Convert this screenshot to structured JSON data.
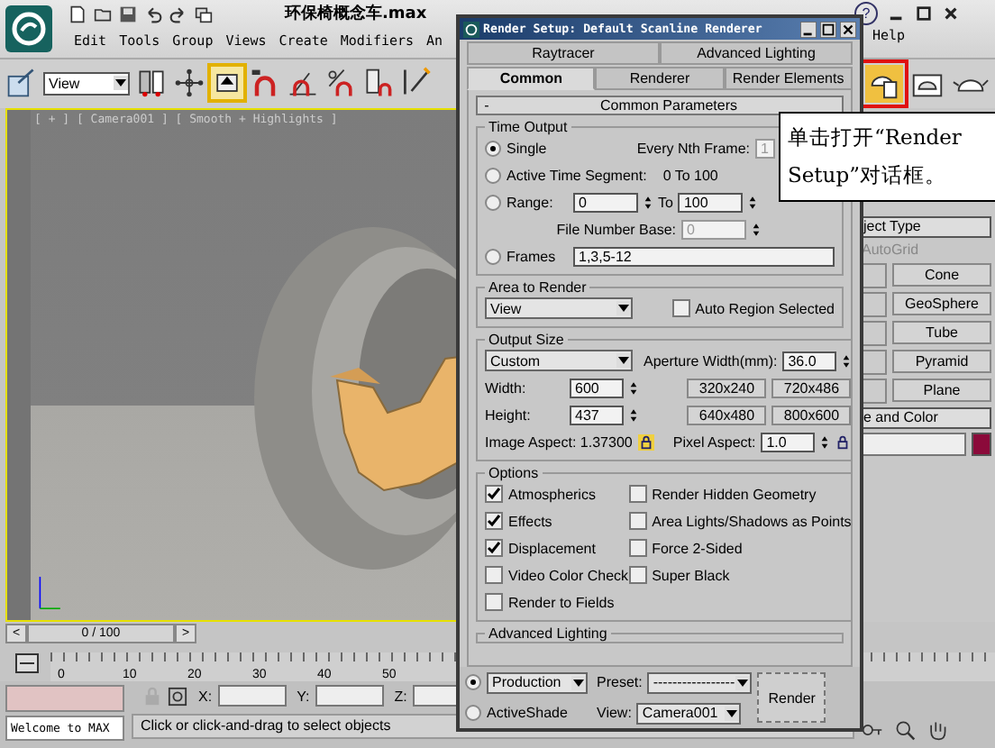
{
  "app": {
    "title": "环保椅概念车.max",
    "menu": [
      "Edit",
      "Tools",
      "Group",
      "Views",
      "Create",
      "Modifiers",
      "An"
    ],
    "help_glyph": "?",
    "help_menu": "Help"
  },
  "toolbar": {
    "view_dropdown": "View"
  },
  "viewport": {
    "label": "[ + ] [ Camera001 ] [ Smooth + Highlights ]"
  },
  "time_slider": {
    "prev": "<",
    "position": "0 / 100",
    "next": ">"
  },
  "track_bar": {
    "ticks": [
      "0",
      "10",
      "20",
      "30",
      "40",
      "50"
    ]
  },
  "status": {
    "prompt": "Welcome to MAX",
    "coords": [
      "X:",
      "Y:",
      "Z:"
    ],
    "message": "Click or click-and-drag to select objects"
  },
  "command_panel": {
    "object_type": "ject Type",
    "autogrid": {
      "label": "AutoGrid",
      "disabled": true
    },
    "buttons": [
      "Cone",
      "GeoSphere",
      "Tube",
      "Pyramid",
      "Plane"
    ],
    "name_color": "e and Color"
  },
  "render_setup": {
    "title": "Render Setup: Default Scanline Renderer",
    "tabs_top": [
      {
        "label": "Raytracer",
        "selected": false
      },
      {
        "label": "Advanced Lighting",
        "selected": false
      }
    ],
    "tabs_bottom": [
      {
        "label": "Common",
        "selected": true
      },
      {
        "label": "Renderer",
        "selected": false
      },
      {
        "label": "Render Elements",
        "selected": false
      }
    ],
    "rollout": {
      "toggle": "-",
      "title": "Common Parameters"
    },
    "time_output": {
      "title": "Time Output",
      "single": {
        "label": "Single",
        "selected": true
      },
      "every_nth": {
        "label": "Every Nth Frame:",
        "value": "1",
        "disabled": true
      },
      "active_segment": {
        "label": "Active Time Segment:",
        "selected": false,
        "range": "0 To 100"
      },
      "range": {
        "label": "Range:",
        "selected": false,
        "from": "0",
        "to_label": "To",
        "to": "100"
      },
      "file_number_base": {
        "label": "File Number Base:",
        "value": "0",
        "disabled": true
      },
      "frames": {
        "label": "Frames",
        "selected": false,
        "value": "1,3,5-12"
      }
    },
    "area_to_render": {
      "title": "Area to Render",
      "dropdown": "View",
      "auto_region": {
        "label": "Auto Region Selected",
        "checked": false
      }
    },
    "output_size": {
      "title": "Output Size",
      "dropdown": "Custom",
      "aperture": {
        "label": "Aperture Width(mm):",
        "value": "36.0"
      },
      "width": {
        "label": "Width:",
        "value": "600"
      },
      "height": {
        "label": "Height:",
        "value": "437"
      },
      "presets": [
        "320x240",
        "720x486",
        "640x480",
        "800x600"
      ],
      "image_aspect": "Image Aspect: 1.37300",
      "pixel_aspect": {
        "label": "Pixel Aspect:",
        "value": "1.0"
      }
    },
    "options": {
      "title": "Options",
      "left": [
        {
          "label": "Atmospherics",
          "checked": true
        },
        {
          "label": "Effects",
          "checked": true
        },
        {
          "label": "Displacement",
          "checked": true
        },
        {
          "label": "Video Color Check",
          "checked": false
        },
        {
          "label": "Render to Fields",
          "checked": false
        }
      ],
      "right": [
        {
          "label": "Render Hidden Geometry",
          "checked": false
        },
        {
          "label": "Area Lights/Shadows as Points",
          "checked": false
        },
        {
          "label": "Force 2-Sided",
          "checked": false
        },
        {
          "label": "Super Black",
          "checked": false
        }
      ]
    },
    "advanced_lighting": {
      "title": "Advanced Lighting"
    },
    "footer": {
      "production": {
        "selected": true,
        "dropdown": "Production"
      },
      "activeshade": {
        "label": "ActiveShade",
        "selected": false
      },
      "preset": {
        "label": "Preset:",
        "value": "-----------------"
      },
      "view": {
        "label": "View:",
        "value": "Camera001"
      },
      "render_button": "Render"
    }
  },
  "callout": {
    "text": "单击打开“Render Setup”对话框。"
  }
}
